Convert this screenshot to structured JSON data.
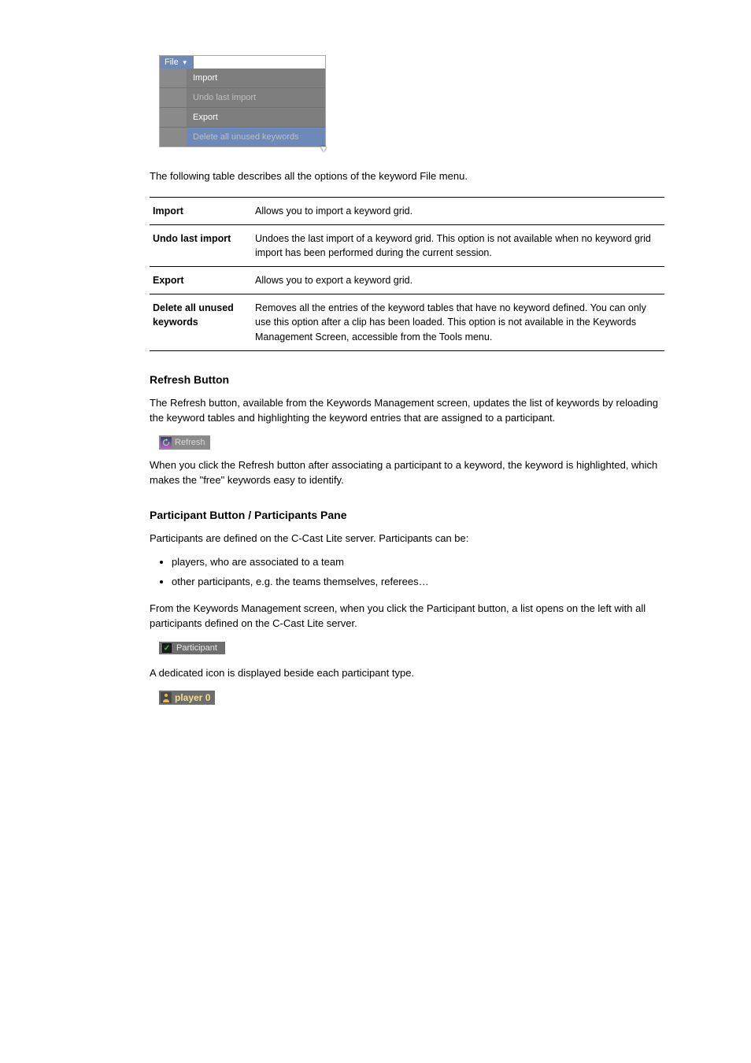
{
  "file_menu": {
    "header": "File",
    "items": [
      {
        "label": "Import",
        "disabled": false
      },
      {
        "label": "Undo last import",
        "disabled": true
      },
      {
        "label": "Export",
        "disabled": false
      },
      {
        "label": "Delete all unused keywords",
        "disabled": true
      }
    ]
  },
  "intro": "The following table describes all the options of the keyword File menu.",
  "table": [
    {
      "option": "Import",
      "description": "Allows you to import a keyword grid."
    },
    {
      "option": "Undo last import",
      "description": "Undoes the last import of a keyword grid. This option is not available when no keyword grid import has been performed during the current session."
    },
    {
      "option": "Export",
      "description": "Allows you to export a keyword grid."
    },
    {
      "option": "Delete all unused keywords",
      "description": "Removes all the entries of the keyword tables that have no keyword defined. You can only use this option after a clip has been loaded. This option is not available in the Keywords Management Screen, accessible from the Tools menu."
    }
  ],
  "sections": {
    "refresh": {
      "heading": "Refresh Button",
      "para1": "The Refresh button, available from the Keywords Management screen, updates the list of keywords by reloading the keyword tables and highlighting the keyword entries that are assigned to a participant.",
      "chip_label": "Refresh",
      "para2": "When you click the Refresh button after associating a participant to a keyword, the keyword is highlighted, which makes the \"free\" keywords easy to identify."
    },
    "participant": {
      "heading": "Participant Button / Participants Pane",
      "para1": "Participants are defined on the C-Cast Lite server. Participants can be:",
      "bullets": [
        "players, who are associated to a team",
        "other participants, e.g. the teams themselves, referees…"
      ],
      "para2": "From the Keywords Management screen, when you click the Participant button, a list opens on the left with all participants defined on the C-Cast Lite server.",
      "chip_label": "Participant",
      "para3": "A dedicated icon is displayed beside each participant type.",
      "player_chip_label": "player 0"
    }
  }
}
